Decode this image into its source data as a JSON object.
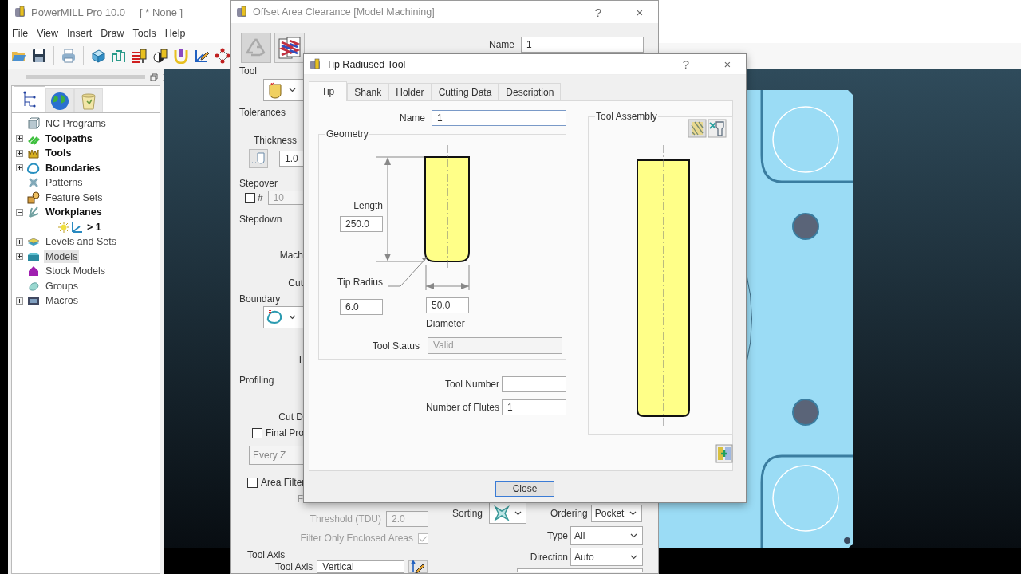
{
  "main_window": {
    "title": "PowerMILL Pro 10.0",
    "project": "[ * None ]",
    "menu": [
      "File",
      "View",
      "Insert",
      "Draw",
      "Tools",
      "Help"
    ]
  },
  "explorer": {
    "tabs": [
      {
        "selected": true
      },
      {
        "selected": false
      },
      {
        "selected": false
      }
    ],
    "items": [
      {
        "label": "NC Programs",
        "bold": false,
        "expandable": false,
        "selected": false
      },
      {
        "label": "Toolpaths",
        "bold": true,
        "expandable": true,
        "expanded": false,
        "selected": false
      },
      {
        "label": "Tools",
        "bold": true,
        "expandable": true,
        "expanded": false,
        "selected": false
      },
      {
        "label": "Boundaries",
        "bold": true,
        "expandable": true,
        "expanded": false,
        "selected": false
      },
      {
        "label": "Patterns",
        "bold": false,
        "expandable": false,
        "selected": false
      },
      {
        "label": "Feature Sets",
        "bold": false,
        "expandable": false,
        "selected": false
      },
      {
        "label": "Workplanes",
        "bold": true,
        "expandable": true,
        "expanded": true,
        "selected": false,
        "children": [
          {
            "label": "> 1",
            "bold": true,
            "expandable": false,
            "selected": false
          }
        ]
      },
      {
        "label": "Levels and Sets",
        "bold": false,
        "expandable": true,
        "expanded": false,
        "selected": false
      },
      {
        "label": "Models",
        "bold": false,
        "expandable": true,
        "expanded": false,
        "selected": true
      },
      {
        "label": "Stock Models",
        "bold": false,
        "expandable": false,
        "selected": false
      },
      {
        "label": "Groups",
        "bold": false,
        "expandable": false,
        "selected": false
      },
      {
        "label": "Macros",
        "bold": false,
        "expandable": true,
        "expanded": false,
        "selected": false
      }
    ]
  },
  "offset_dialog": {
    "title": "Offset Area Clearance [Model Machining]",
    "help": "?",
    "close": "×",
    "name": {
      "label": "Name",
      "value": "1"
    },
    "tool": {
      "title": "Tool"
    },
    "tolerances": {
      "title": "Tolerances",
      "thickness_label": "Thickness",
      "thickness": "1.0"
    },
    "stepover": {
      "title": "Stepover",
      "checked": false,
      "symbol": "#",
      "value": "10",
      "disabled": true
    },
    "stepdown": {
      "title": "Stepdown",
      "cut_texts": [
        "Mach",
        "Cut"
      ]
    },
    "boundary": {
      "title": "Boundary",
      "cut_text": "T"
    },
    "profiling": {
      "title": "Profiling",
      "cut_text": "Cut D",
      "final_pass": {
        "label": "Final Pro",
        "checked": false
      },
      "frequency": {
        "value": "Every Z",
        "disabled": true
      }
    },
    "area_filter": {
      "label": "Area Filter",
      "checked": false,
      "cut_text": "F",
      "threshold": {
        "label": "Threshold (TDU)",
        "value": "2.0",
        "disabled": true
      },
      "enclosed_only": {
        "label": "Filter Only Enclosed Areas",
        "checked": true,
        "disabled": true
      }
    },
    "tool_axis": {
      "title": "Tool Axis",
      "label": "Tool Axis",
      "value": "Vertical"
    },
    "sorting": {
      "label": "Sorting"
    },
    "ordering": {
      "label": "Ordering",
      "value": "Pocket"
    },
    "type": {
      "label": "Type",
      "value": "All"
    },
    "direction": {
      "label": "Direction",
      "value": "Auto"
    }
  },
  "tip_dialog": {
    "title": "Tip Radiused Tool",
    "help": "?",
    "close": "×",
    "tabs": [
      {
        "label": "Tip",
        "selected": true
      },
      {
        "label": "Shank",
        "selected": false
      },
      {
        "label": "Holder",
        "selected": false
      },
      {
        "label": "Cutting Data",
        "selected": false
      },
      {
        "label": "Description",
        "selected": false
      }
    ],
    "name": {
      "label": "Name",
      "value": "1"
    },
    "geometry": {
      "title": "Geometry",
      "length": {
        "label": "Length",
        "value": "250.0"
      },
      "tip_radius": {
        "label": "Tip Radius",
        "value": "6.0"
      },
      "diameter": {
        "label": "Diameter",
        "value": "50.0"
      },
      "tool_status": {
        "label": "Tool Status",
        "value": "Valid"
      }
    },
    "tool_number": {
      "label": "Tool Number"
    },
    "flutes": {
      "label": "Number of Flutes",
      "value": "1"
    },
    "assembly": {
      "title": "Tool Assembly"
    },
    "close_button": "Close"
  }
}
